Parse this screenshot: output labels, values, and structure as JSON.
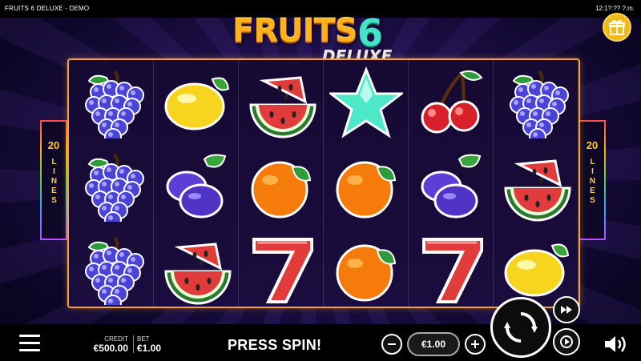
{
  "window": {
    "title": "FRUITS 6 DELUXE - DEMO",
    "clock": "12:1?:?? ?.m."
  },
  "logo": {
    "word": "FRUITS",
    "number": "6",
    "subtitle": "DELUXE"
  },
  "paylines": {
    "count": "20",
    "label": "LINES"
  },
  "reels": [
    [
      "grapes",
      "grapes",
      "grapes"
    ],
    [
      "lemon",
      "plum",
      "watermelon"
    ],
    [
      "watermelon",
      "orange",
      "seven"
    ],
    [
      "star",
      "orange",
      "orange"
    ],
    [
      "cherries",
      "plum",
      "seven"
    ],
    [
      "grapes",
      "watermelon",
      "lemon"
    ]
  ],
  "status": {
    "credit_label": "CREDIT",
    "credit_value": "€500.00",
    "bet_label": "BET",
    "bet_value": "€1.00",
    "message": "PRESS SPIN!"
  },
  "controls": {
    "bet_selector_value": "€1.00",
    "minus_icon": "minus-icon",
    "plus_icon": "plus-icon",
    "spin_icon": "spin-arrows-icon",
    "fast_icon": "fast-forward-icon",
    "autoplay_icon": "autoplay-icon",
    "sound_icon": "speaker-icon",
    "menu_icon": "hamburger-menu-icon",
    "gift_icon": "gift-icon"
  },
  "colors": {
    "reel_frame": "#f0a43a",
    "logo_orange": "#ffb21c",
    "logo_teal": "#43e4c8",
    "lines_text": "#ffcf3a",
    "gift_button": "#f3b81a"
  }
}
